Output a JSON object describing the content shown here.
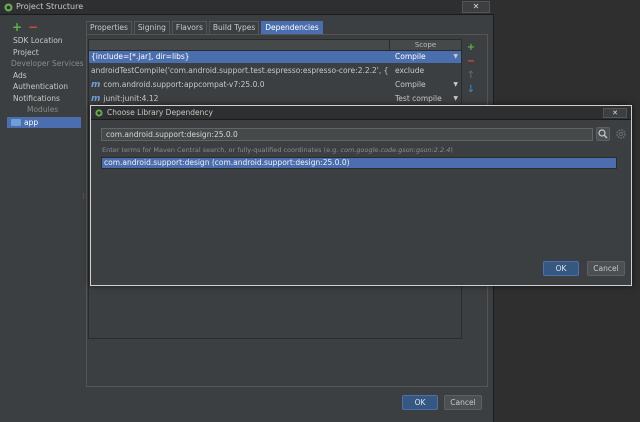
{
  "window": {
    "title": "Project Structure",
    "close_label": "✕"
  },
  "sidebar": {
    "add_label": "+",
    "remove_label": "−",
    "items": [
      {
        "label": "SDK Location"
      },
      {
        "label": "Project"
      },
      {
        "label": "Developer Services"
      },
      {
        "label": "Ads"
      },
      {
        "label": "Authentication"
      },
      {
        "label": "Notifications"
      },
      {
        "label": "Modules"
      },
      {
        "label": "app"
      }
    ]
  },
  "tabs": [
    {
      "label": "Properties"
    },
    {
      "label": "Signing"
    },
    {
      "label": "Flavors"
    },
    {
      "label": "Build Types"
    },
    {
      "label": "Dependencies"
    }
  ],
  "dependencies": {
    "header_scope": "Scope",
    "rows": [
      {
        "name": "{include=[*.jar], dir=libs}",
        "scope": "Compile"
      },
      {
        "name": "androidTestCompile('com.android.support.test.espresso:espresso-core:2.2.2', {",
        "scope": "exclude"
      },
      {
        "name": "com.android.support:appcompat-v7:25.0.0",
        "scope": "Compile"
      },
      {
        "name": "junit:junit:4.12",
        "scope": "Test compile"
      }
    ],
    "tools": {
      "add": "+",
      "remove": "−",
      "up": "↑",
      "down": "↓"
    }
  },
  "main_buttons": {
    "ok": "OK",
    "cancel": "Cancel"
  },
  "dialog": {
    "title": "Choose Library Dependency",
    "close_label": "✕",
    "search_value": "com.android.support:design:25.0.0",
    "hint_prefix": "Enter terms for Maven Central search, or fully-qualified coordinates (e.g.",
    "hint_example": "com.google.code.gson:gson:2.2.4",
    "hint_suffix": ")",
    "result": "com.android.support:design (com.android.support:design:25.0.0)",
    "ok": "OK",
    "cancel": "Cancel"
  },
  "colors": {
    "background": "#2b2b2b",
    "panel": "#3c3f41",
    "selection": "#4b6eaf",
    "add_green": "#5fb24a",
    "remove_red": "#d94a3c"
  }
}
